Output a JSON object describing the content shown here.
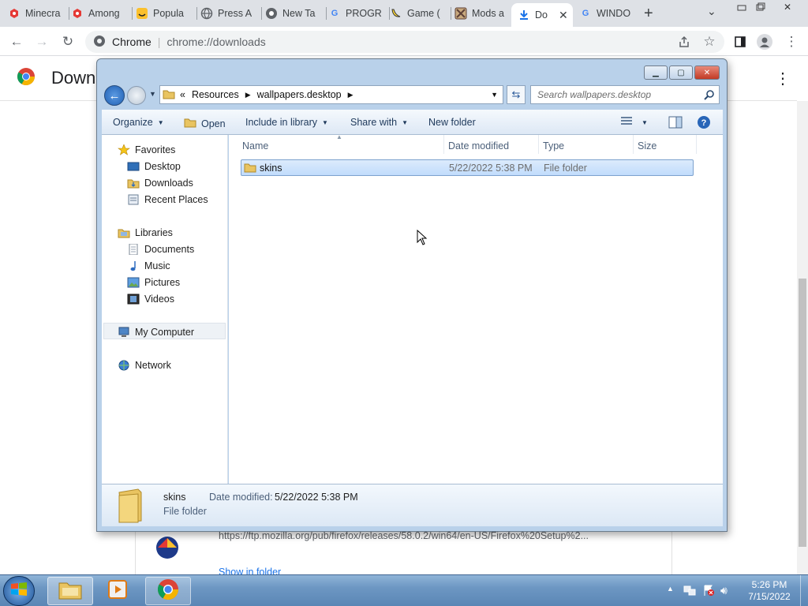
{
  "browser": {
    "tabs": [
      {
        "label": "Minecra",
        "icon": "minecraft-app-icon",
        "color": "#e53935"
      },
      {
        "label": "Among",
        "icon": "among-us-app-icon",
        "color": "#e53935"
      },
      {
        "label": "Popula",
        "icon": "smiley-icon",
        "color": "#fbc02d"
      },
      {
        "label": "Press A",
        "icon": "globe-icon",
        "color": "#5f6368"
      },
      {
        "label": "New Ta",
        "icon": "chrome-icon",
        "color": "#5f6368"
      },
      {
        "label": "PROGR",
        "icon": "google-icon",
        "color": "#4285f4"
      },
      {
        "label": "Game (",
        "icon": "banana-icon",
        "color": "#fdd835"
      },
      {
        "label": "Mods a",
        "icon": "mods-icon",
        "color": "#795548"
      },
      {
        "label": "Do",
        "icon": "download-icon",
        "color": "#1a73e8"
      },
      {
        "label": "WINDO",
        "icon": "google-icon",
        "color": "#4285f4"
      }
    ],
    "omnibox_site": "Chrome",
    "omnibox_url": "chrome://downloads",
    "page_title": "Down",
    "download_url": "https://ftp.mozilla.org/pub/firefox/releases/58.0.2/win64/en-US/Firefox%20Setup%2...",
    "show_in_folder": "Show in folder"
  },
  "explorer": {
    "breadcrumb": [
      "Resources",
      "wallpapers.desktop"
    ],
    "breadcrumb_prefix": "«",
    "search_placeholder": "Search wallpapers.desktop",
    "commands": {
      "organize": "Organize",
      "open": "Open",
      "include_in_library": "Include in library",
      "share_with": "Share with",
      "new_folder": "New folder"
    },
    "nav": {
      "favorites": "Favorites",
      "desktop": "Desktop",
      "downloads": "Downloads",
      "recent_places": "Recent Places",
      "libraries": "Libraries",
      "documents": "Documents",
      "music": "Music",
      "pictures": "Pictures",
      "videos": "Videos",
      "my_computer": "My Computer",
      "network": "Network"
    },
    "columns": {
      "name": "Name",
      "date": "Date modified",
      "type": "Type",
      "size": "Size"
    },
    "rows": [
      {
        "name": "skins",
        "date": "5/22/2022 5:38 PM",
        "type": "File folder",
        "size": ""
      }
    ],
    "details": {
      "name": "skins",
      "date_label": "Date modified:",
      "date_value": "5/22/2022 5:38 PM",
      "type": "File folder"
    }
  },
  "taskbar": {
    "time": "5:26 PM",
    "date": "7/15/2022"
  },
  "colors": {
    "explorer_frame": "#b9d1ea",
    "selection": "#cce4fc",
    "taskbar": "#6d97c3",
    "chrome_blue": "#1a73e8"
  }
}
